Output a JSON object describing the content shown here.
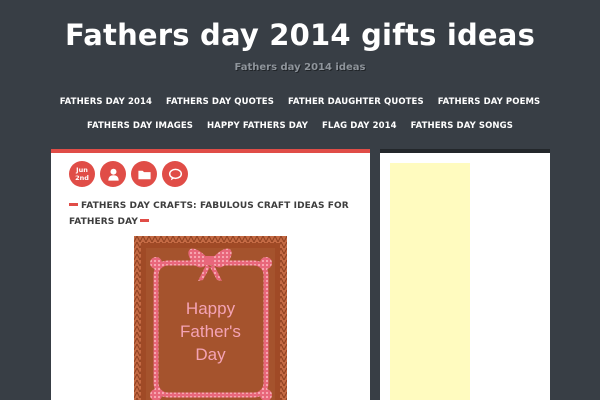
{
  "site": {
    "title": "Fathers day 2014 gifts ideas",
    "description": "Fathers day 2014 ideas"
  },
  "nav": {
    "row1": [
      "FATHERS DAY 2014",
      "FATHERS DAY QUOTES",
      "FATHER DAUGHTER QUOTES",
      "FATHERS DAY POEMS"
    ],
    "row2": [
      "FATHERS DAY IMAGES",
      "HAPPY FATHERS DAY",
      "FLAG DAY 2014",
      "FATHERS DAY SONGS"
    ]
  },
  "post": {
    "date_month": "Jun",
    "date_day": "2nd",
    "title": "FATHERS DAY CRAFTS: FABULOUS CRAFT IDEAS FOR FATHERS DAY",
    "image_text": [
      "Happy",
      "Father's",
      "Day"
    ],
    "meta_icons": [
      "user-icon",
      "folder-icon",
      "comment-icon"
    ]
  },
  "colors": {
    "background": "#383e45",
    "accent": "#e04d47",
    "sidebar_ad": "#fffbbf",
    "card_brown": "#a04a26"
  }
}
